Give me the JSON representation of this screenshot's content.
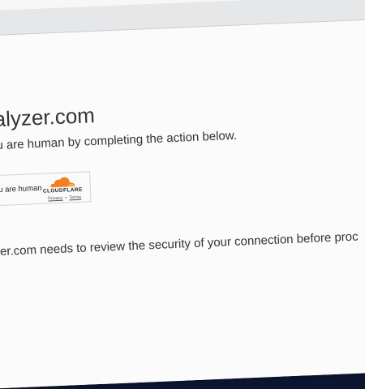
{
  "page": {
    "site_title": "nalyzer.com",
    "instruction": "you are human by completing the action below.",
    "security_note": "yzer.com needs to review the security of your connection before proc"
  },
  "widget": {
    "label": "y you are human",
    "brand": "CLOUDFLARE",
    "privacy_link": "Privacy",
    "separator": "•",
    "terms_link": "Terms",
    "brand_color": "#f38020",
    "brand_color_light": "#faae40"
  },
  "icons": {
    "logo": "cloudflare-cloud-icon"
  }
}
